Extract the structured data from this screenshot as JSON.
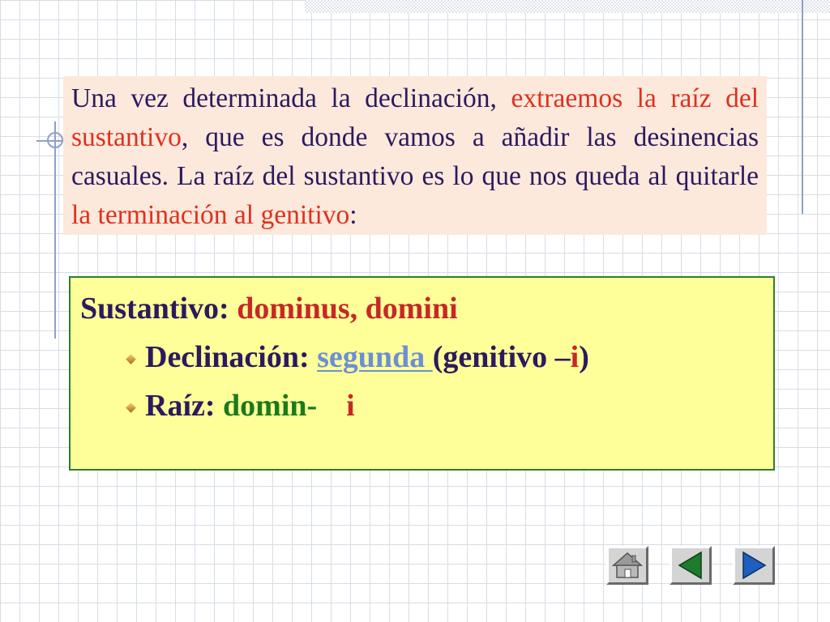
{
  "intro": {
    "p1": "Una vez determinada la declinación,",
    "p2": "extraemos la raíz del sustantivo",
    "p3": ", que es donde vamos a añadir las desinencias casuales. La raíz del sustantivo es lo que nos queda al quitarle",
    "p4": "la terminación al genitivo",
    "p5": ":"
  },
  "main": {
    "noun_label": "Sustantivo:",
    "noun_value": "dominus, domini",
    "decl_label": "Declinación:",
    "decl_link": "segunda ",
    "decl_genitive_open": "(genitivo –",
    "decl_genitive_ending": "i",
    "decl_genitive_close": ")",
    "root_label": "Raíz:",
    "root_value": "domin-",
    "root_ending": "i"
  },
  "nav": {
    "icons": [
      "home-icon",
      "previous-arrow-icon",
      "next-arrow-icon"
    ]
  },
  "colors": {
    "text": "#2b1a5e",
    "highlight_red": "#e0301e",
    "dark_red": "#c62828",
    "green": "#1b7a1b",
    "link_blue": "#6b8fd6",
    "intro_bg": "#fde9dc",
    "box_bg": "#ffff99",
    "box_border": "#2e7d32"
  }
}
